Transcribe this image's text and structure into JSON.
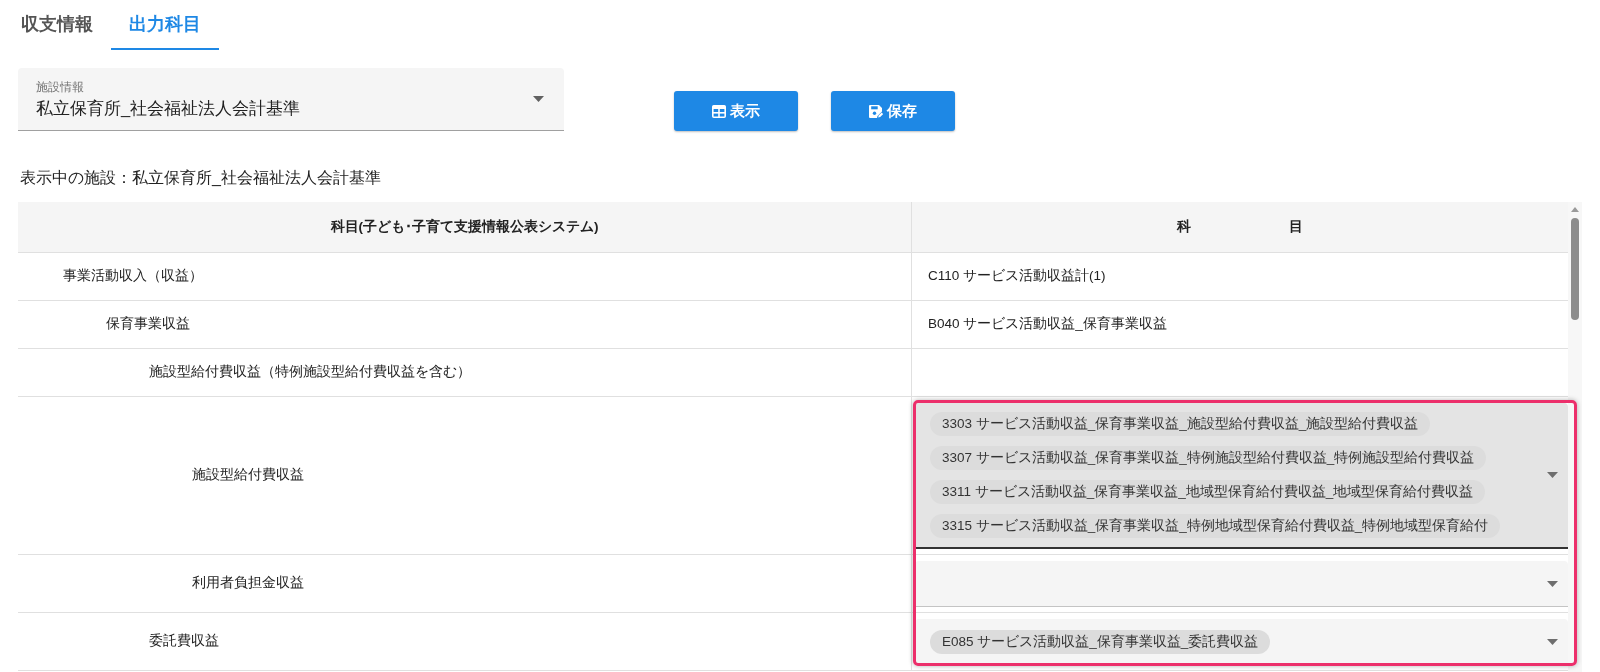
{
  "tabs": [
    {
      "label": "収支情報",
      "selected": false
    },
    {
      "label": "出力科目",
      "selected": true
    }
  ],
  "facility_select": {
    "label": "施設情報",
    "value": "私立保育所_社会福祉法人会計基準"
  },
  "buttons": [
    {
      "label": "表示",
      "kind": "view"
    },
    {
      "label": "保存",
      "kind": "save"
    }
  ],
  "current_facility": "表示中の施設：私立保育所_社会福祉法人会計基準",
  "table": {
    "columns": [
      "科目(子ども･子育て支援情報公表システム)",
      "科　　　　　　　目"
    ],
    "rows": [
      {
        "label": "事業活動収入（収益）",
        "kind": "text",
        "account": "C110 サービス活動収益計(1)",
        "highlighted": false,
        "children": [
          {
            "label": "保育事業収益",
            "kind": "text",
            "account": "B040 サービス活動収益_保育事業収益",
            "highlighted": false,
            "children": [
              {
                "label": "施設型給付費収益（特例施設型給付費収益を含む）",
                "kind": "text",
                "highlighted": false,
                "children": [
                  {
                    "label": "施設型給付費収益",
                    "kind": "select",
                    "focused": true,
                    "highlighted": true,
                    "chips": [
                      "3303 サービス活動収益_保育事業収益_施設型給付費収益_施設型給付費収益",
                      "3307 サービス活動収益_保育事業収益_特例施設型給付費収益_特例施設型給付費収益",
                      "3311 サービス活動収益_保育事業収益_地域型保育給付費収益_地域型保育給付費収益",
                      "3315 サービス活動収益_保育事業収益_特例地域型保育給付費収益_特例地域型保育給付"
                    ]
                  },
                  {
                    "label": "利用者負担金収益",
                    "kind": "select",
                    "focused": false,
                    "highlighted": true
                  }
                ]
              },
              {
                "label": "委託費収益",
                "kind": "select",
                "focused": false,
                "highlighted": true,
                "chips": [
                  "E085 サービス活動収益_保育事業収益_委託費収益"
                ]
              }
            ]
          }
        ]
      }
    ]
  }
}
